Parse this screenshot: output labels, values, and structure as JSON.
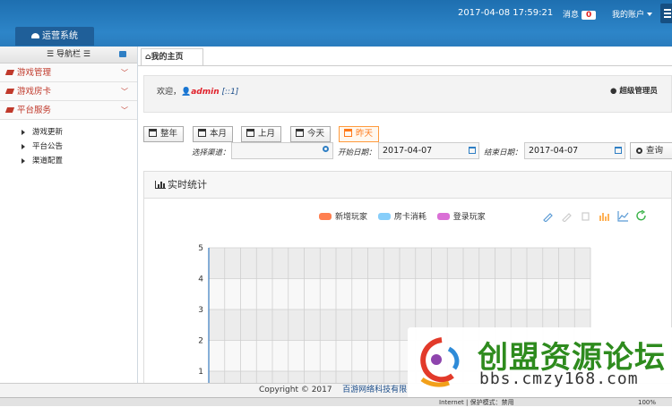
{
  "header": {
    "system_tab": "运营系统",
    "datetime": "2017-04-08 17:59:21",
    "messages_label": "消息",
    "messages_count": "0",
    "account_label": "我的账户"
  },
  "sidebar": {
    "title": "导航栏",
    "menus": [
      {
        "label": "游戏管理"
      },
      {
        "label": "游戏房卡"
      },
      {
        "label": "平台服务"
      }
    ],
    "subitems": [
      {
        "label": "游戏更新"
      },
      {
        "label": "平台公告"
      },
      {
        "label": "渠道配置"
      }
    ]
  },
  "main": {
    "tab": "我的主页",
    "welcome_prefix": "欢迎，",
    "user": "admin",
    "user_tag": "[::1]",
    "role": "超级管理员",
    "period_buttons": [
      "整年",
      "本月",
      "上月",
      "今天",
      "昨天"
    ],
    "active_period": "昨天",
    "channel_label": "选择渠道：",
    "channel_value": "",
    "start_label": "开始日期：",
    "start_date": "2017-04-07",
    "end_label": "结束日期：",
    "end_date": "2017-04-07",
    "query_button": "查询",
    "panel_title": "实时统计"
  },
  "chart_data": {
    "type": "bar",
    "title": "",
    "series": [
      {
        "name": "新增玩家",
        "color": "#ff7f50",
        "values": []
      },
      {
        "name": "房卡消耗",
        "color": "#87cefa",
        "values": []
      },
      {
        "name": "登录玩家",
        "color": "#da70d6",
        "values": []
      }
    ],
    "y_ticks": [
      "1",
      "2",
      "3",
      "4",
      "5"
    ],
    "ylim": [
      0,
      5
    ],
    "grid": true,
    "toolbox_icons": [
      "mark-icon",
      "mark-undo-icon",
      "mark-clear-icon",
      "bar-chart-icon",
      "line-chart-icon",
      "refresh-icon"
    ]
  },
  "footer": {
    "copyright": "Copyright © 2017",
    "company": "百游网络科技有限"
  },
  "statusbar": {
    "text": "Internet | 保护模式：禁用",
    "zoom": "100%"
  },
  "watermark": {
    "title": "创盟资源论坛",
    "url": "bbs.cmzy168.com"
  }
}
